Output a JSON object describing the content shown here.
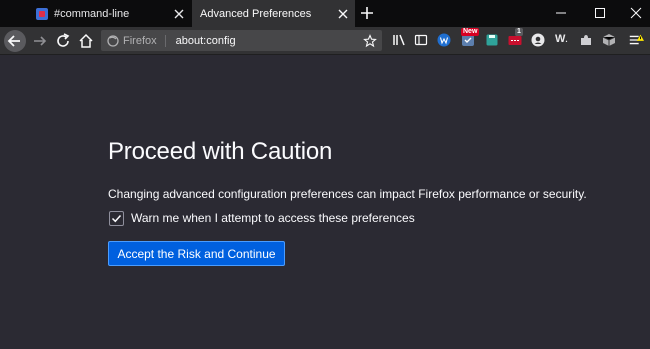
{
  "tabs": [
    {
      "label": "#command-line",
      "active": false
    },
    {
      "label": "Advanced Preferences",
      "active": true
    }
  ],
  "urlbar": {
    "identity_label": "Firefox",
    "url": "about:config"
  },
  "toolbar_badges": {
    "new_badge": "New",
    "count_badge": "1",
    "w_ext": "W"
  },
  "content": {
    "title": "Proceed with Caution",
    "warning": "Changing advanced configuration preferences can impact Firefox performance or security.",
    "checkbox_label": "Warn me when I attempt to access these preferences",
    "checkbox_checked": true,
    "accept_button": "Accept the Risk and Continue"
  },
  "colors": {
    "page_bg": "#2b2a33",
    "tabstrip_bg": "#0c0c0d",
    "toolbar_bg": "#323234",
    "urlbar_bg": "#474749",
    "accent": "#0060df",
    "badge_red": "#d70022",
    "hamburger_warning": "#ffe900"
  },
  "icons": {
    "tab1_favicon": "command-line-favicon",
    "back": "arrow-left-icon",
    "forward": "arrow-right-icon",
    "reload": "reload-icon",
    "home": "home-icon",
    "bookmark": "star-icon",
    "library": "library-icon",
    "sidebar": "sidebar-icon",
    "menu": "hamburger-icon"
  }
}
